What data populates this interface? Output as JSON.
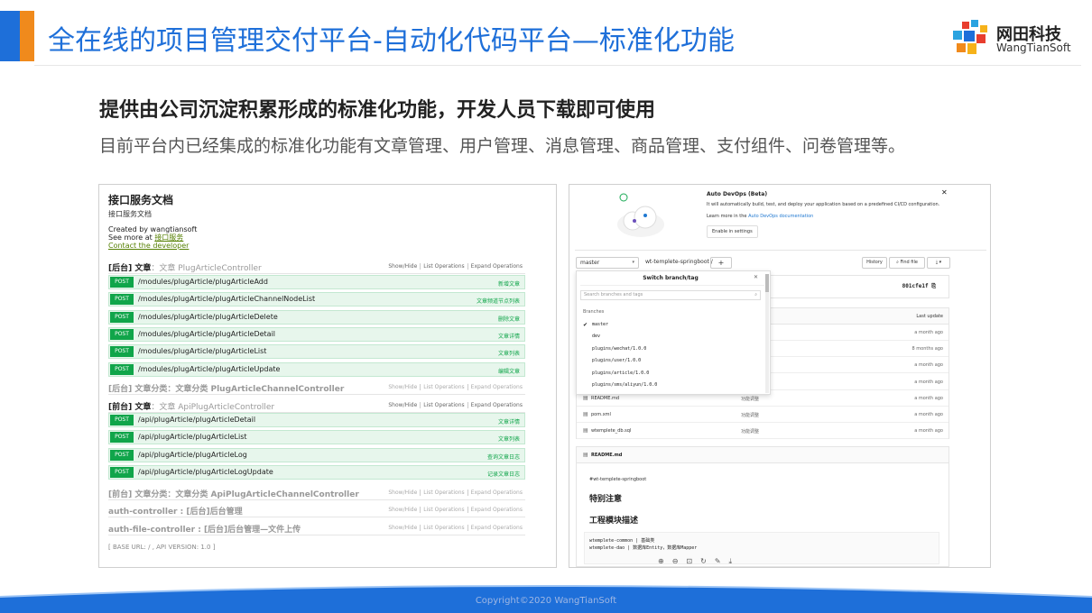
{
  "header": {
    "title": "全在线的项目管理交付平台-自动化代码平台—标准化功能",
    "logo_cn": "网田科技",
    "logo_en": "WangTianSoft"
  },
  "subtitle": "提供由公司沉淀积累形成的标准化功能，开发人员下载即可使用",
  "description": "目前平台内已经集成的标准化功能有文章管理、用户管理、消息管理、商品管理、支付组件、问卷管理等。",
  "api_doc": {
    "title": "接口服务文档",
    "sub": "接口服务文档",
    "created_by": "Created by wangtiansoft",
    "see_more_prefix": "See more at ",
    "see_more_link": "接口服务",
    "contact": "Contact the developer",
    "link_show_hide": "Show/Hide",
    "link_list": "List Operations",
    "link_expand": "Expand Operations",
    "post": "POST",
    "groups": [
      {
        "name": "[后台] 文章",
        "dim": "：文章 PlugArticleController"
      },
      {
        "name": "[后台] 文章分类：文章分类 PlugArticleChannelController"
      },
      {
        "name": "[前台] 文章",
        "dim": "：文章 ApiPlugArticleController"
      },
      {
        "name": "[前台] 文章分类：文章分类 ApiPlugArticleChannelController"
      },
      {
        "name": "auth-controller : [后台]后台管理"
      },
      {
        "name": "auth-file-controller : [后台]后台管理—文件上传"
      }
    ],
    "ops1": [
      {
        "path": "/modules/plugArticle/plugArticleAdd",
        "desc": "新增文章"
      },
      {
        "path": "/modules/plugArticle/plugArticleChannelNodeList",
        "desc": "文章频道节点列表"
      },
      {
        "path": "/modules/plugArticle/plugArticleDelete",
        "desc": "删除文章"
      },
      {
        "path": "/modules/plugArticle/plugArticleDetail",
        "desc": "文章详情"
      },
      {
        "path": "/modules/plugArticle/plugArticleList",
        "desc": "文章列表"
      },
      {
        "path": "/modules/plugArticle/plugArticleUpdate",
        "desc": "编辑文章"
      }
    ],
    "ops2": [
      {
        "path": "/api/plugArticle/plugArticleDetail",
        "desc": "文章详情"
      },
      {
        "path": "/api/plugArticle/plugArticleList",
        "desc": "文章列表"
      },
      {
        "path": "/api/plugArticle/plugArticleLog",
        "desc": "查询文章日志"
      },
      {
        "path": "/api/plugArticle/plugArticleLogUpdate",
        "desc": "记录文章日志"
      }
    ],
    "base_url": "[ BASE URL: / , API VERSION: 1.0 ]"
  },
  "repo": {
    "devops_title": "Auto DevOps (Beta)",
    "devops_text": "It will automatically build, test, and deploy your application based on a predefined CI/CD configuration.",
    "devops_learn_prefix": "Learn more in the ",
    "devops_learn_link": "Auto DevOps documentation",
    "enable_btn": "Enable in settings",
    "branch": "master",
    "repo_name": "wt-templete-springboot /",
    "history": "History",
    "find_file": "Find file",
    "commit_sha": "801cfe1f",
    "last_update": "Last update",
    "dropdown_title": "Switch branch/tag",
    "search_placeholder": "Search branches and tags",
    "branches_label": "Branches",
    "branches": [
      "master",
      "dev",
      "plugins/wechat/1.0.0",
      "plugins/user/1.0.0",
      "plugins/article/1.0.0",
      "plugins/sms/aliyun/1.0.0"
    ],
    "files": [
      {
        "name": "",
        "commit": "",
        "time": "a month ago"
      },
      {
        "name": "",
        "commit": "",
        "time": "8 months ago"
      },
      {
        "name": "",
        "commit": "",
        "time": "a month ago"
      },
      {
        "name": "",
        "commit": "",
        "time": "a month ago"
      },
      {
        "name": "README.md",
        "commit": "功能调整",
        "time": "a month ago"
      },
      {
        "name": "pom.xml",
        "commit": "功能调整",
        "time": "a month ago"
      },
      {
        "name": "wtemplete_db.sql",
        "commit": "功能调整",
        "time": "a month ago"
      }
    ],
    "readme_title": "README.md",
    "readme_h1": "#wt-templete-springboot",
    "readme_h2": "特别注意",
    "readme_h3": "工程模块描述",
    "readme_code_1": "wtemplete-common | 基础类",
    "readme_code_2": "wtemplete-dao | 数据库Entity，数据库Mapper"
  },
  "footer": {
    "copyright": "Copyright©2020 WangTianSoft"
  },
  "colors": {
    "accent_blue": "#1e6fd9",
    "accent_orange": "#f08a1c",
    "post_green": "#10a54a",
    "footer_blue": "#1e6fd9"
  }
}
